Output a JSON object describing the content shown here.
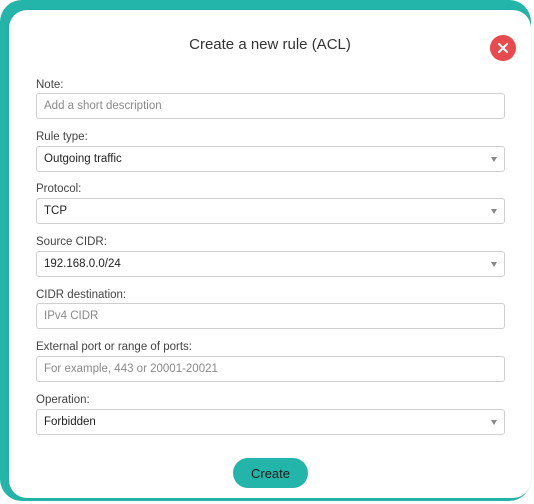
{
  "dialog": {
    "title": "Create a new rule (ACL)",
    "close_icon": "close-icon",
    "accent_color": "#23b5a9",
    "close_color": "#e84a4e"
  },
  "fields": {
    "note": {
      "label": "Note:",
      "placeholder": "Add a short description"
    },
    "rule_type": {
      "label": "Rule type:",
      "value": "Outgoing traffic"
    },
    "protocol": {
      "label": "Protocol:",
      "value": "TCP"
    },
    "source_cidr": {
      "label": "Source CIDR:",
      "value": "192.168.0.0/24"
    },
    "cidr_destination": {
      "label": "CIDR destination:",
      "placeholder": "IPv4 CIDR"
    },
    "port": {
      "label": "External port or range of ports:",
      "placeholder": "For example, 443 or 20001-20021"
    },
    "operation": {
      "label": "Operation:",
      "value": "Forbidden"
    }
  },
  "actions": {
    "create_label": "Create"
  }
}
